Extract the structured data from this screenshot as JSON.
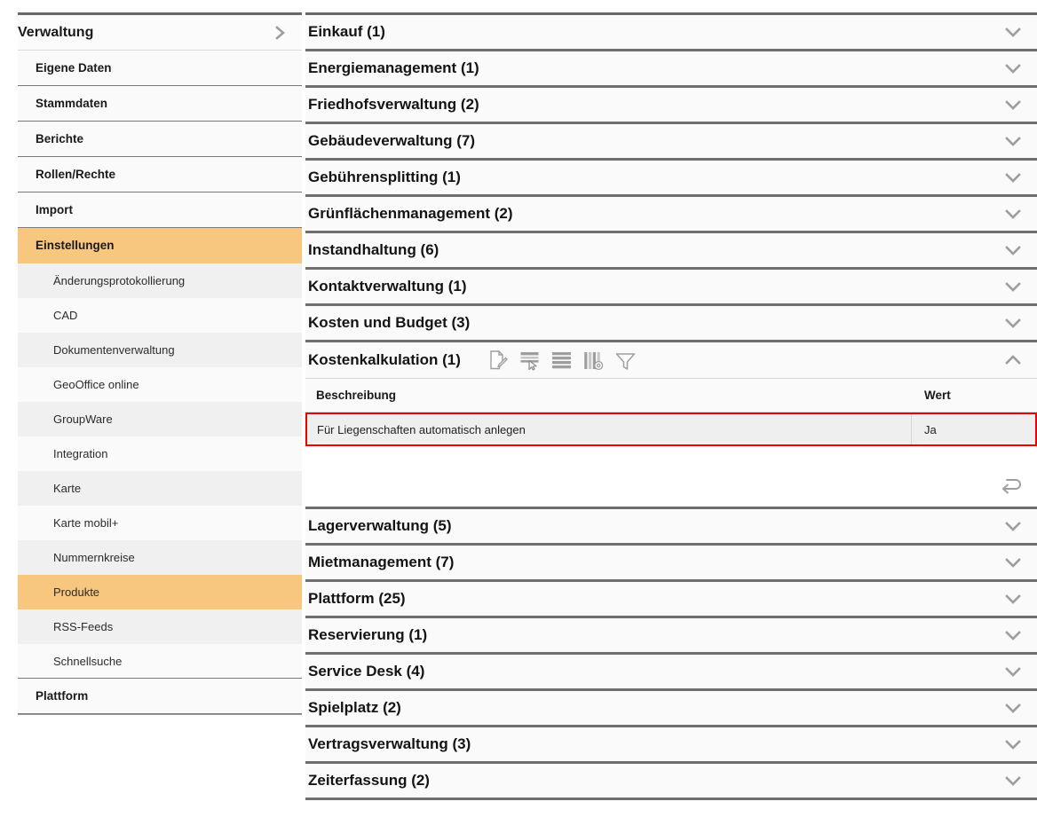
{
  "sidebar": {
    "header": {
      "label": "Verwaltung",
      "icon": "chevron-right-icon"
    },
    "items": [
      {
        "label": "Eigene Daten",
        "level": 1,
        "active": false
      },
      {
        "label": "Stammdaten",
        "level": 1,
        "active": false
      },
      {
        "label": "Berichte",
        "level": 1,
        "active": false
      },
      {
        "label": "Rollen/Rechte",
        "level": 1,
        "active": false
      },
      {
        "label": "Import",
        "level": 1,
        "active": false
      },
      {
        "label": "Einstellungen",
        "level": 1,
        "active": true
      },
      {
        "label": "Änderungsprotokollierung",
        "level": 2,
        "active": false
      },
      {
        "label": "CAD",
        "level": 2,
        "active": false
      },
      {
        "label": "Dokumentenverwaltung",
        "level": 2,
        "active": false
      },
      {
        "label": "GeoOffice online",
        "level": 2,
        "active": false
      },
      {
        "label": "GroupWare",
        "level": 2,
        "active": false
      },
      {
        "label": "Integration",
        "level": 2,
        "active": false
      },
      {
        "label": "Karte",
        "level": 2,
        "active": false
      },
      {
        "label": "Karte mobil+",
        "level": 2,
        "active": false
      },
      {
        "label": "Nummernkreise",
        "level": 2,
        "active": false
      },
      {
        "label": "Produkte",
        "level": 2,
        "active": true
      },
      {
        "label": "RSS-Feeds",
        "level": 2,
        "active": false
      },
      {
        "label": "Schnellsuche",
        "level": 2,
        "active": false
      },
      {
        "label": "Plattform",
        "level": 1,
        "active": false
      }
    ]
  },
  "main": {
    "sections": [
      {
        "title": "Einkauf (1)",
        "expanded": false
      },
      {
        "title": "Energiemanagement (1)",
        "expanded": false
      },
      {
        "title": "Friedhofsverwaltung (2)",
        "expanded": false
      },
      {
        "title": "Gebäudeverwaltung (7)",
        "expanded": false
      },
      {
        "title": "Gebührensplitting (1)",
        "expanded": false
      },
      {
        "title": "Grünflächenmanagement (2)",
        "expanded": false
      },
      {
        "title": "Instandhaltung (6)",
        "expanded": false
      },
      {
        "title": "Kontaktverwaltung (1)",
        "expanded": false
      },
      {
        "title": "Kosten und Budget (3)",
        "expanded": false
      },
      {
        "title": "Kostenkalkulation (1)",
        "expanded": true
      },
      {
        "title": "Lagerverwaltung (5)",
        "expanded": false
      },
      {
        "title": "Mietmanagement (7)",
        "expanded": false
      },
      {
        "title": "Plattform (25)",
        "expanded": false
      },
      {
        "title": "Reservierung (1)",
        "expanded": false
      },
      {
        "title": "Service Desk (4)",
        "expanded": false
      },
      {
        "title": "Spielplatz (2)",
        "expanded": false
      },
      {
        "title": "Vertragsverwaltung (3)",
        "expanded": false
      },
      {
        "title": "Zeiterfassung (2)",
        "expanded": false
      }
    ],
    "expanded_section": {
      "title": "Kostenkalkulation (1)",
      "toolbar": [
        {
          "name": "edit-document-icon",
          "title": "Bearbeiten"
        },
        {
          "name": "select-row-icon",
          "title": "Zeile auswählen"
        },
        {
          "name": "list-rows-icon",
          "title": "Listenansicht"
        },
        {
          "name": "column-settings-icon",
          "title": "Spalten konfigurieren"
        },
        {
          "name": "filter-funnel-icon",
          "title": "Filter"
        }
      ],
      "table": {
        "columns": [
          "Beschreibung",
          "Wert"
        ],
        "rows": [
          {
            "beschreibung": "Für Liegenschaften automatisch anlegen",
            "wert": "Ja",
            "selected": true
          }
        ]
      },
      "reload_icon": "return-arrow-icon"
    }
  },
  "colors": {
    "accent_orange": "#f7c780",
    "selection_red": "#ee0000",
    "row_bg": "#fafafa",
    "alt_row_bg": "#f0f0f0",
    "divider_dark": "#6e6e6e",
    "icon_gray": "#9e9e9e"
  }
}
